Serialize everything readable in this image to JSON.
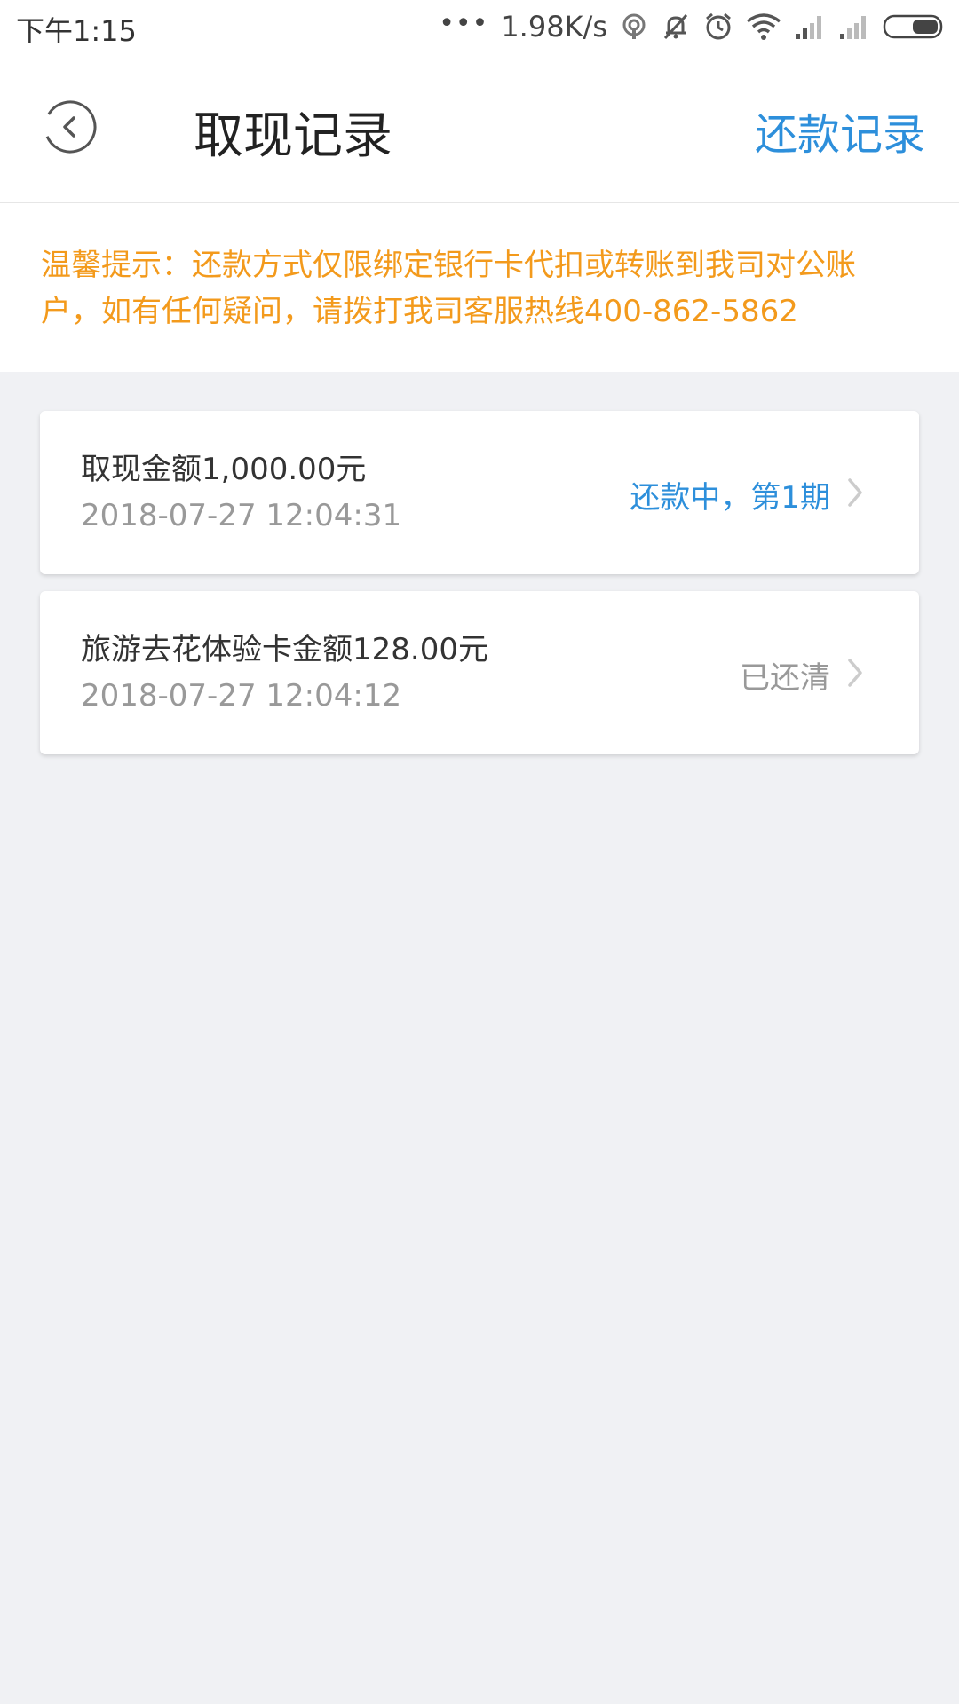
{
  "status_bar": {
    "time": "下午1:15",
    "dots": "•••",
    "speed": "1.98K/s",
    "icons": [
      "hotspot-icon",
      "mute-icon",
      "alarm-icon",
      "wifi-icon",
      "signal-icon",
      "signal-icon",
      "battery-icon"
    ]
  },
  "header": {
    "back_icon": "back-circle-icon",
    "title": "取现记录",
    "link": "还款记录"
  },
  "notice": {
    "text": "温馨提示：还款方式仅限绑定银行卡代扣或转账到我司对公账户，如有任何疑问，请拨打我司客服热线400-862-5862"
  },
  "records": [
    {
      "title": "取现金额1,000.00元",
      "time": "2018-07-27 12:04:31",
      "status": "还款中，第1期",
      "status_color": "#2d8fdb"
    },
    {
      "title": "旅游去花体验卡金额128.00元",
      "time": "2018-07-27 12:04:12",
      "status": "已还清",
      "status_color": "#999999"
    }
  ],
  "colors": {
    "accent": "#2d8fdb",
    "notice": "#f39a1c",
    "background": "#f0f1f4"
  }
}
